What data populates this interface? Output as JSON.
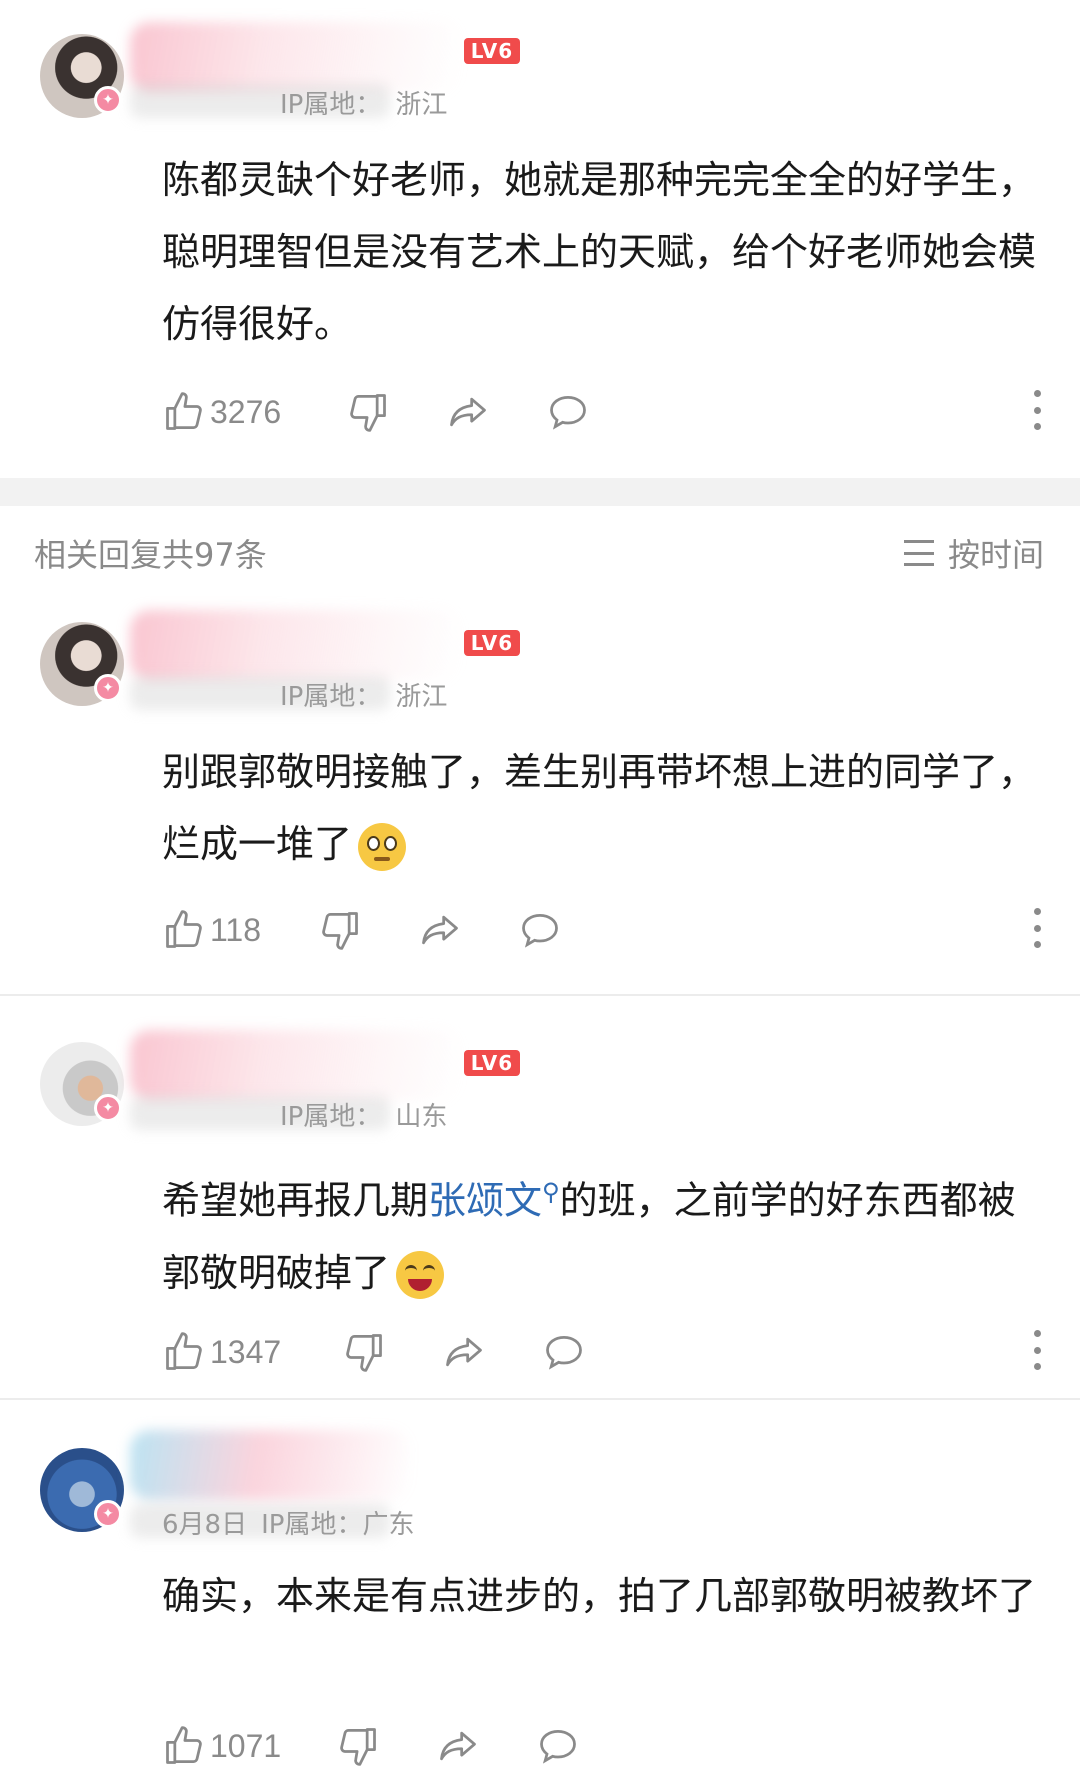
{
  "colors": {
    "accent_link": "#2e6bb5",
    "level_badge": "#f04b4b",
    "muted": "#8a8a8a"
  },
  "top_comment": {
    "level_badge": "LV6",
    "location_label": "IP属地：",
    "location": "浙江",
    "text": "陈都灵缺个好老师，她就是那种完完全全的好学生，聪明理智但是没有艺术上的天赋，给个好老师她会模仿得很好。",
    "likes": "3276"
  },
  "replies_header": {
    "count_text": "相关回复共97条",
    "sort_label": "按时间"
  },
  "replies": [
    {
      "level_badge": "LV6",
      "location_label": "IP属地：",
      "location": "浙江",
      "text": "别跟郭敬明接触了，差生别再带坏想上进的同学了，烂成一堆了",
      "emoji": "eye-roll-emoji",
      "likes": "118"
    },
    {
      "level_badge": "LV6",
      "location_label": "IP属地：",
      "location": "山东",
      "text_before": "希望她再报几期",
      "link": "张颂文",
      "text_after": "的班，之前学的好东西都被郭敬明破掉了",
      "emoji": "laughing-emoji",
      "likes": "1347"
    },
    {
      "date": "6月8日",
      "location_label": "IP属地：",
      "location": "广东",
      "text": "确实，本来是有点进步的，拍了几部郭敬明被教坏了",
      "likes": "1071"
    }
  ]
}
